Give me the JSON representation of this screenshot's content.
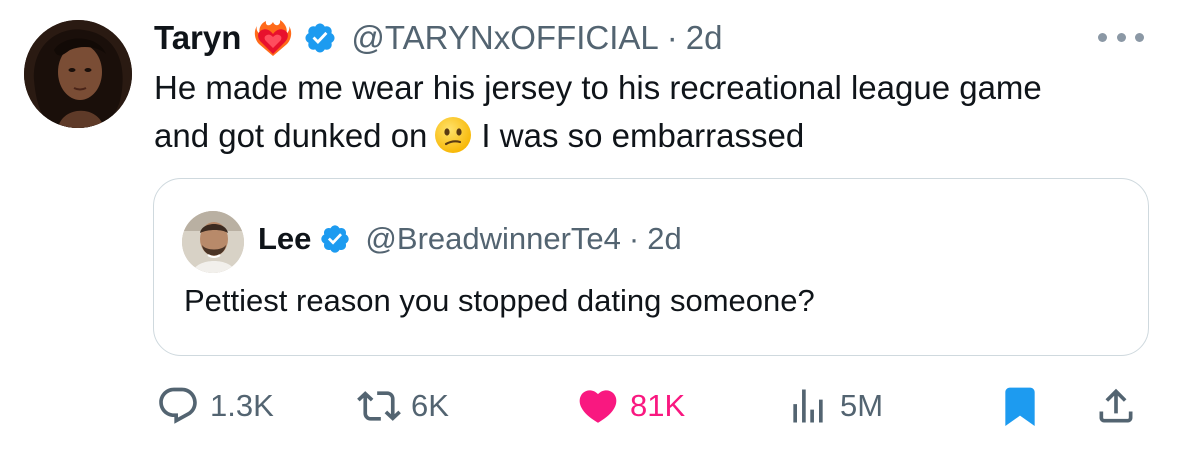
{
  "tweet": {
    "author_name": "Taryn",
    "author_handle": "@TARYNxOFFICIAL",
    "separator": "·",
    "time": "2d",
    "text_line1": "He made me wear his jersey to his recreational league game",
    "text_line2a": "and got dunked on",
    "text_line2b": "I was so embarrassed",
    "icons": {
      "name_emoji": "heart-on-fire-icon",
      "verified": "verified-badge-icon",
      "text_emoji": "confused-face-icon",
      "more": "more-options-icon"
    }
  },
  "quoted": {
    "author_name": "Lee",
    "author_handle": "@BreadwinnerTe4",
    "separator": "·",
    "time": "2d",
    "text": "Pettiest reason you stopped dating someone?"
  },
  "actions": {
    "replies": "1.3K",
    "reposts": "6K",
    "likes": "81K",
    "views": "5M"
  },
  "colors": {
    "text_primary": "#0f1419",
    "text_secondary": "#536471",
    "verified_blue": "#1d9bf0",
    "like_pink": "#f91880",
    "border": "#cfd9de"
  }
}
